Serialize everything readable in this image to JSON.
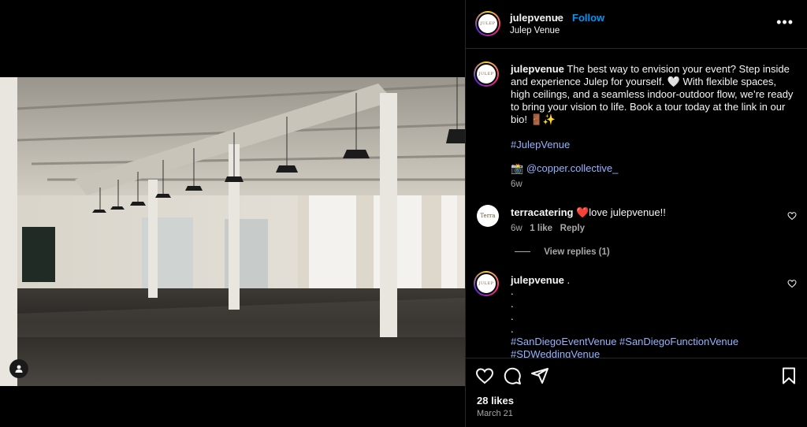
{
  "post": {
    "username": "julepvenue",
    "follow_label": "Follow",
    "location": "Julep Venue",
    "avatar_text": "JULEP",
    "more_label": "•••",
    "caption_user": "julepvenue",
    "caption_text": "The best way to envision your event? Step inside and experience Julep for yourself. 🤍 With flexible spaces, high ceilings, and a seamless indoor-outdoor flow, we’re ready to bring your vision to life. Book a tour today at the link in our bio! 🚪✨",
    "hashtag": "#JulepVenue",
    "credit_emoji": "📸",
    "credit_handle": "@copper.collective_",
    "caption_time": "6w",
    "likes": "28 likes",
    "date": "March 21"
  },
  "comments": [
    {
      "username": "terracatering",
      "avatar_text": "Terra",
      "text": "❤️love julepvenue!!",
      "time": "6w",
      "likes": "1 like",
      "reply_label": "Reply",
      "view_replies": "View replies (1)"
    },
    {
      "username": "julepvenue",
      "text": ".",
      "dots": [
        ".",
        ".",
        ".",
        "."
      ],
      "hashtags_line1": "#SanDiegoEventVenue #SanDiegoFunctionVenue",
      "hashtags_line2": "#SDWeddingVenue"
    }
  ],
  "icons": [
    "heart-icon",
    "comment-icon",
    "share-icon",
    "bookmark-icon",
    "more-icon",
    "user-tag-icon"
  ]
}
